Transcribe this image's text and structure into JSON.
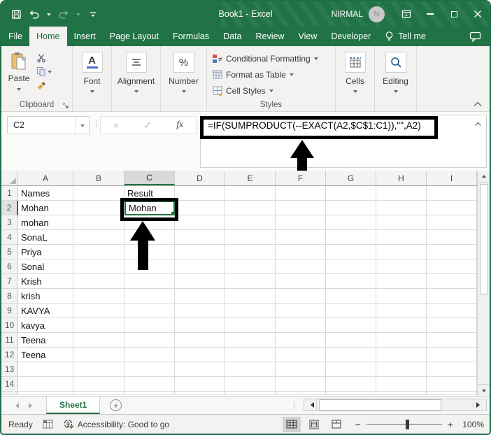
{
  "title_bar": {
    "title": "Book1 - Excel",
    "user_name": "NIRMAL",
    "avatar_initial": "N"
  },
  "menu_bar": {
    "tabs": [
      "File",
      "Home",
      "Insert",
      "Page Layout",
      "Formulas",
      "Data",
      "Review",
      "View",
      "Developer"
    ],
    "active_tab": "Home",
    "tell_me": "Tell me"
  },
  "ribbon": {
    "paste_label": "Paste",
    "clipboard_label": "Clipboard",
    "font_label": "Font",
    "alignment_label": "Alignment",
    "number_label": "Number",
    "styles": {
      "conditional_formatting": "Conditional Formatting",
      "format_as_table": "Format as Table",
      "cell_styles": "Cell Styles",
      "label": "Styles"
    },
    "cells_label": "Cells",
    "editing_label": "Editing"
  },
  "formula_bar": {
    "name_box": "C2",
    "formula": "=IF(SUMPRODUCT(--EXACT(A2,$C$1:C1)),\"\",A2)"
  },
  "icons": {
    "dots_separator": "⋮",
    "cancel": "×",
    "enter": "✓",
    "fx": "fx",
    "font_a": "A",
    "percent": "%",
    "not_equal": "≠",
    "add_sheet": "+",
    "zoom_out": "−",
    "zoom_in": "+"
  },
  "grid": {
    "columns": [
      "A",
      "B",
      "C",
      "D",
      "E",
      "F",
      "G",
      "H",
      "I"
    ],
    "rows": [
      {
        "n": "1",
        "a": "Names",
        "c": "Result"
      },
      {
        "n": "2",
        "a": "Mohan",
        "c": "Mohan"
      },
      {
        "n": "3",
        "a": "mohan",
        "c": ""
      },
      {
        "n": "4",
        "a": "SonaL",
        "c": ""
      },
      {
        "n": "5",
        "a": "Priya",
        "c": ""
      },
      {
        "n": "6",
        "a": "Sonal",
        "c": ""
      },
      {
        "n": "7",
        "a": "Krish",
        "c": ""
      },
      {
        "n": "8",
        "a": "krish",
        "c": ""
      },
      {
        "n": "9",
        "a": "KAVYA",
        "c": ""
      },
      {
        "n": "10",
        "a": "kavya",
        "c": ""
      },
      {
        "n": "11",
        "a": "Teena",
        "c": ""
      },
      {
        "n": "12",
        "a": "Teena",
        "c": ""
      },
      {
        "n": "13",
        "a": "",
        "c": ""
      },
      {
        "n": "14",
        "a": "",
        "c": ""
      }
    ]
  },
  "sheet_bar": {
    "sheet_name": "Sheet1"
  },
  "status_bar": {
    "mode": "Ready",
    "accessibility": "Accessibility: Good to go",
    "zoom_level": "100%"
  }
}
